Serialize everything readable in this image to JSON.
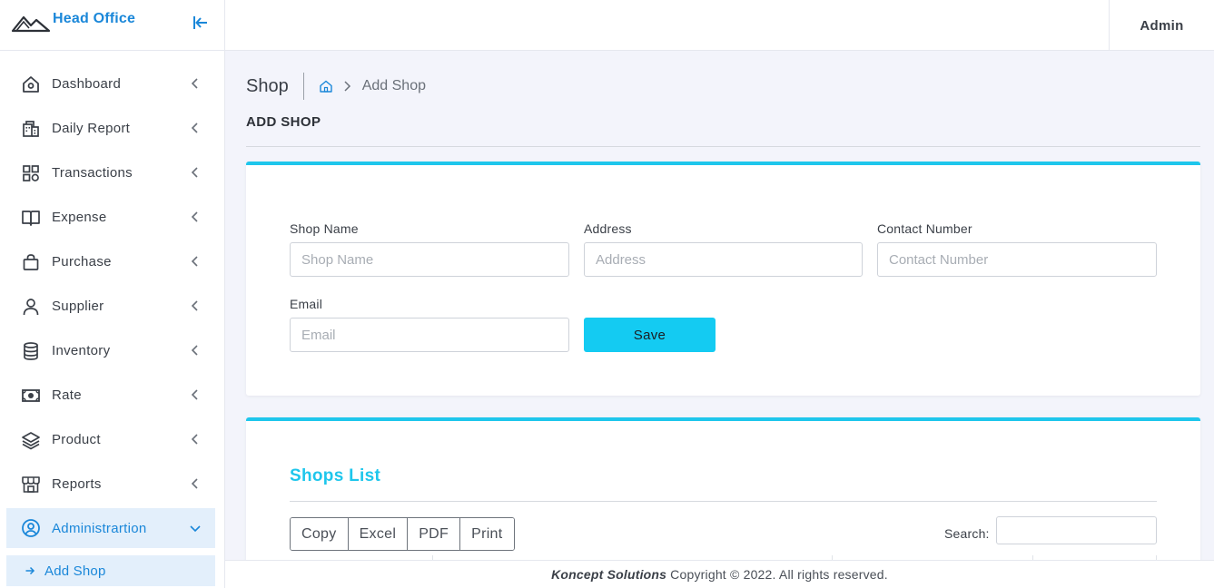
{
  "brand": {
    "title": "Head Office"
  },
  "topbar": {
    "user": "Admin"
  },
  "sidebar": {
    "items": [
      {
        "label": "Dashboard",
        "icon": "home-icon"
      },
      {
        "label": "Daily Report",
        "icon": "building-icon"
      },
      {
        "label": "Transactions",
        "icon": "grid-icon"
      },
      {
        "label": "Expense",
        "icon": "book-icon"
      },
      {
        "label": "Purchase",
        "icon": "shopping-bag-icon"
      },
      {
        "label": "Supplier",
        "icon": "user-icon"
      },
      {
        "label": "Inventory",
        "icon": "database-icon"
      },
      {
        "label": "Rate",
        "icon": "money-icon"
      },
      {
        "label": "Product",
        "icon": "layers-icon"
      },
      {
        "label": "Reports",
        "icon": "store-icon"
      },
      {
        "label": "Administrartion",
        "icon": "user-circle-icon",
        "active": true
      }
    ],
    "subitem": {
      "label": "Add Shop"
    }
  },
  "page": {
    "title": "Shop",
    "breadcrumb": "Add Shop",
    "section": "ADD SHOP"
  },
  "form": {
    "shop_name": {
      "label": "Shop Name",
      "placeholder": "Shop Name",
      "value": ""
    },
    "address": {
      "label": "Address",
      "placeholder": "Address",
      "value": ""
    },
    "contact": {
      "label": "Contact Number",
      "placeholder": "Contact Number",
      "value": ""
    },
    "email": {
      "label": "Email",
      "placeholder": "Email",
      "value": ""
    },
    "save_label": "Save"
  },
  "list": {
    "title": "Shops List",
    "buttons": [
      "Copy",
      "Excel",
      "PDF",
      "Print"
    ],
    "search_label": "Search:",
    "search_value": ""
  },
  "footer": {
    "company": "Koncept Solutions",
    "text": "Copyright © 2022. All rights reserved."
  },
  "colors": {
    "accent": "#1a87d9",
    "cyan": "#1ec6ec",
    "save": "#14cbf2",
    "background": "#f3f4fb"
  }
}
